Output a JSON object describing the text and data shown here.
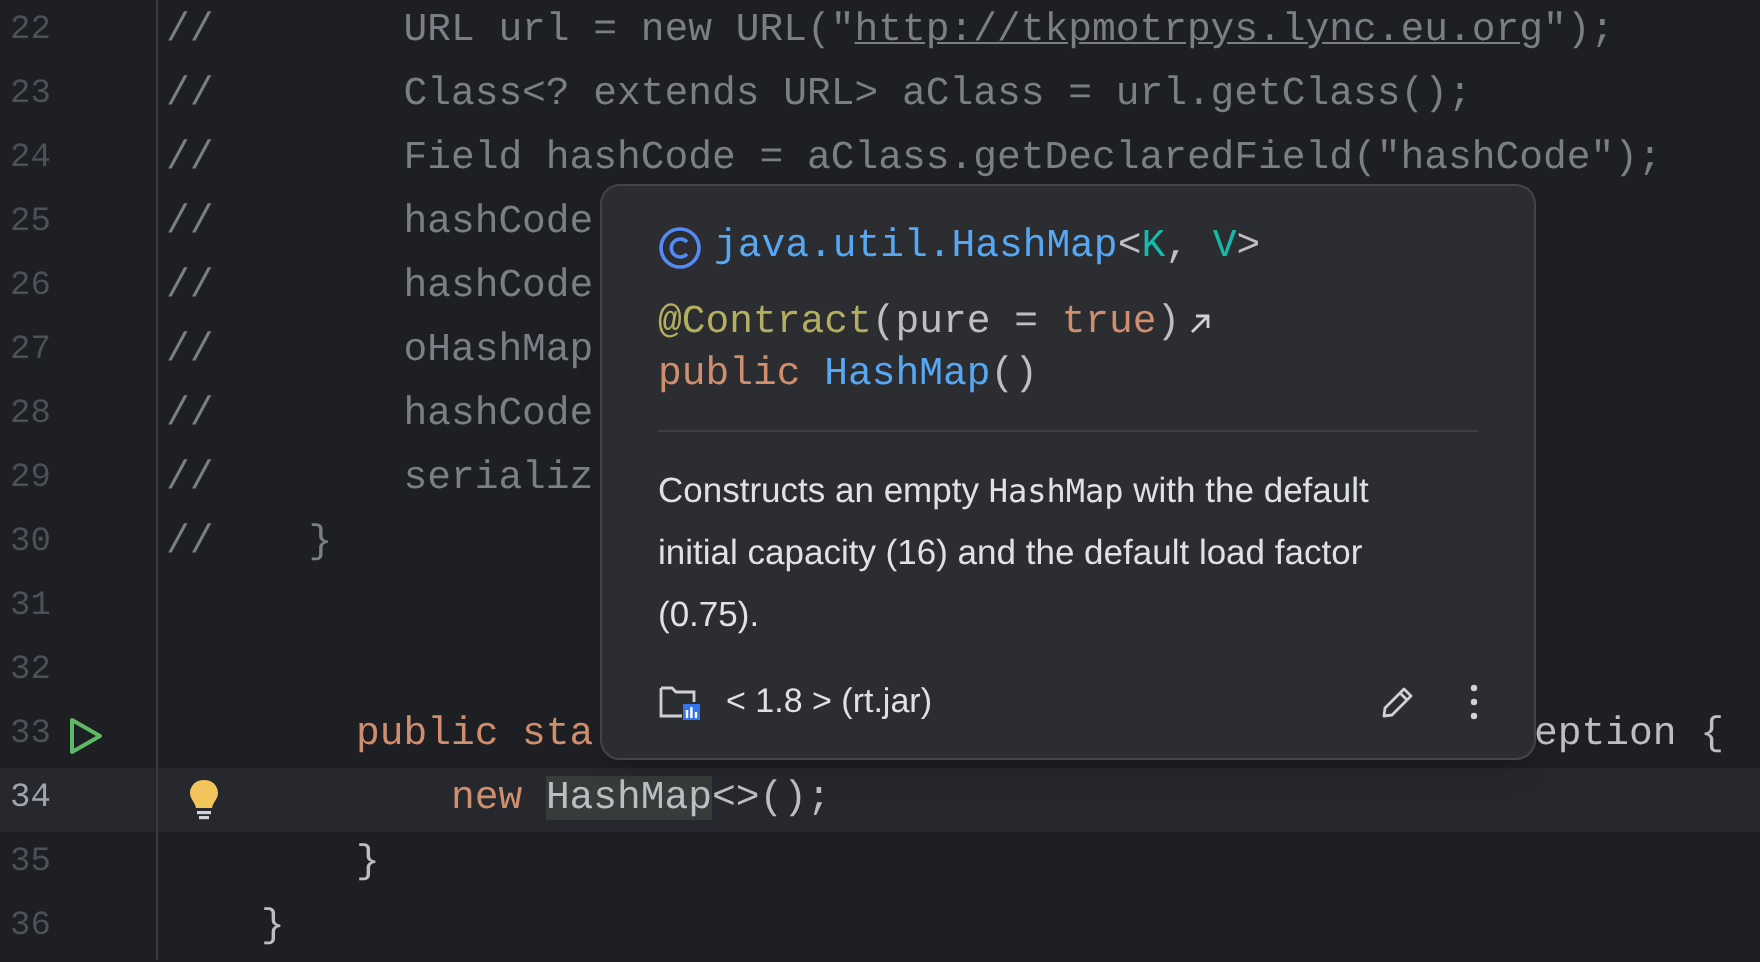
{
  "editor": {
    "lines": [
      {
        "number": "22",
        "current": false,
        "tokens": [
          {
            "text": "//        URL url = new URL(\"",
            "kind": "comment"
          },
          {
            "text": "http://tkpmotrpys.lync.eu.org",
            "kind": "link"
          },
          {
            "text": "\");",
            "kind": "comment"
          }
        ]
      },
      {
        "number": "23",
        "current": false,
        "tokens": [
          {
            "text": "//        Class<? extends URL> aClass = url.getClass();",
            "kind": "comment"
          }
        ]
      },
      {
        "number": "24",
        "current": false,
        "tokens": [
          {
            "text": "//        Field hashCode = aClass.getDeclaredField(\"hashCode\");",
            "kind": "comment"
          }
        ]
      },
      {
        "number": "25",
        "current": false,
        "tokens": [
          {
            "text": "//        hashCode",
            "kind": "comment"
          }
        ]
      },
      {
        "number": "26",
        "current": false,
        "tokens": [
          {
            "text": "//        hashCode",
            "kind": "comment"
          }
        ]
      },
      {
        "number": "27",
        "current": false,
        "tokens": [
          {
            "text": "//        oHashMap",
            "kind": "comment"
          }
        ]
      },
      {
        "number": "28",
        "current": false,
        "tokens": [
          {
            "text": "//        hashCode",
            "kind": "comment"
          }
        ]
      },
      {
        "number": "29",
        "current": false,
        "tokens": [
          {
            "text": "//        serializ",
            "kind": "comment"
          }
        ]
      },
      {
        "number": "30",
        "current": false,
        "tokens": [
          {
            "text": "//    }",
            "kind": "comment"
          }
        ]
      },
      {
        "number": "31",
        "current": false
      },
      {
        "number": "32",
        "current": false
      },
      {
        "number": "33",
        "current": false,
        "runnable": true,
        "tokens": [
          {
            "text": "        public sta",
            "kind": "keyword"
          }
        ],
        "tokens_right": [
          {
            "text": "eption {",
            "kind": "plain"
          }
        ]
      },
      {
        "number": "34",
        "current": true,
        "intention_bulb": true,
        "tokens": [
          {
            "text": "            new ",
            "kind": "keyword"
          },
          {
            "text": "HashMap",
            "kind": "highlighted"
          },
          {
            "text": "<>();",
            "kind": "plain"
          }
        ]
      },
      {
        "number": "35",
        "current": false,
        "tokens": [
          {
            "text": "        }",
            "kind": "plain"
          }
        ]
      },
      {
        "number": "36",
        "current": false,
        "tokens": [
          {
            "text": "    }",
            "kind": "plain"
          }
        ]
      }
    ]
  },
  "popup": {
    "header": [
      {
        "text": "java.util.HashMap",
        "kind": "class"
      },
      {
        "text": "<",
        "kind": "plain"
      },
      {
        "text": "K",
        "kind": "type_param"
      },
      {
        "text": ", ",
        "kind": "plain"
      },
      {
        "text": "V",
        "kind": "type_param"
      },
      {
        "text": ">",
        "kind": "plain"
      }
    ],
    "signature": [
      {
        "link_icon": true,
        "tokens": [
          {
            "text": "@Contract",
            "kind": "annotation"
          },
          {
            "text": "(pure = ",
            "kind": "plain"
          },
          {
            "text": "true",
            "kind": "keyword"
          },
          {
            "text": ")",
            "kind": "plain"
          }
        ]
      },
      {
        "link_icon": false,
        "tokens": [
          {
            "text": "public ",
            "kind": "keyword"
          },
          {
            "text": "HashMap",
            "kind": "class"
          },
          {
            "text": "()",
            "kind": "plain"
          }
        ]
      }
    ],
    "description": [
      {
        "text": "Constructs an empty ",
        "kind": "text"
      },
      {
        "text": "HashMap",
        "kind": "code"
      },
      {
        "text": " with the default initial capacity (16) and the default load factor (0.75).",
        "kind": "text"
      }
    ],
    "source": "< 1.8 > (rt.jar)"
  }
}
